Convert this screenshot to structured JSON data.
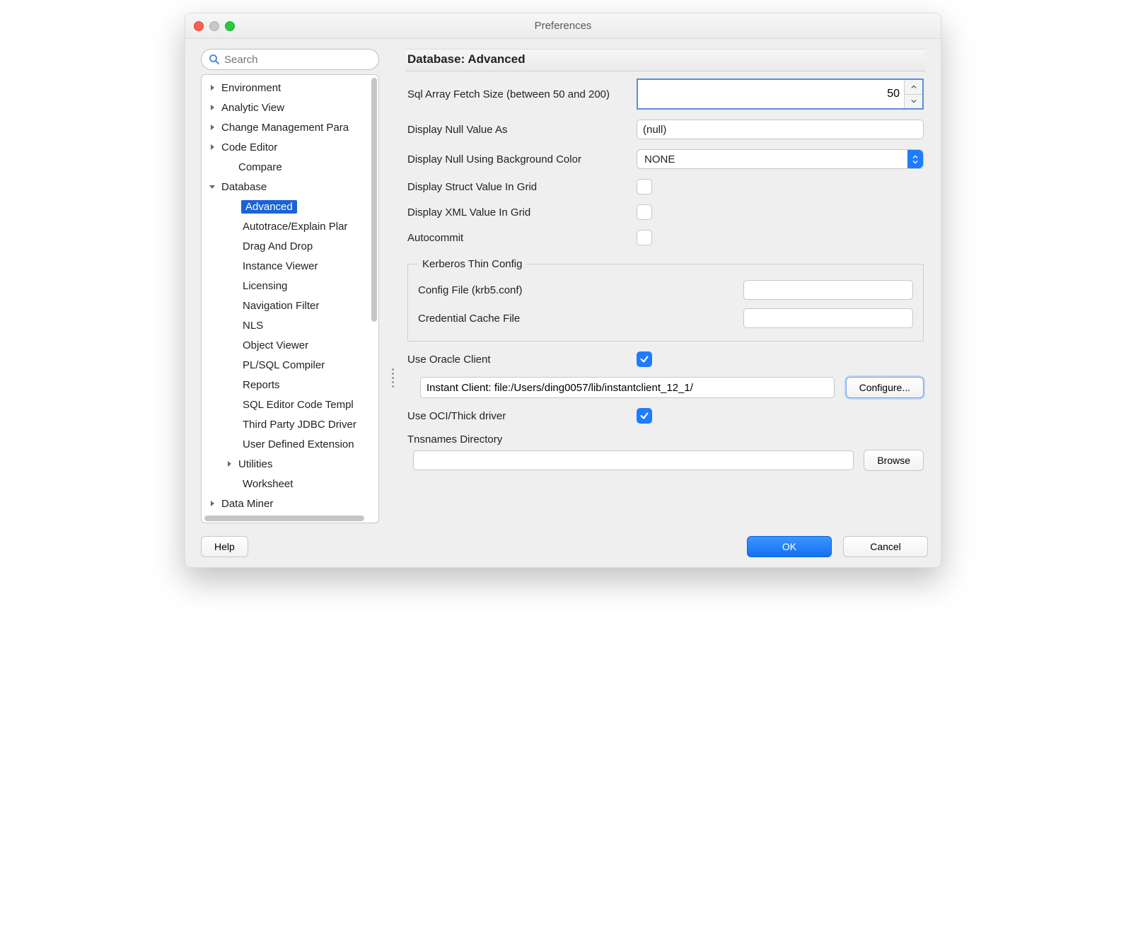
{
  "window": {
    "title": "Preferences"
  },
  "search": {
    "placeholder": "Search"
  },
  "sidebar": {
    "items": [
      {
        "label": "Environment",
        "arrow": "right",
        "depth": 0
      },
      {
        "label": "Analytic View",
        "arrow": "right",
        "depth": 0
      },
      {
        "label": "Change Management Para",
        "arrow": "right",
        "depth": 0
      },
      {
        "label": "Code Editor",
        "arrow": "right",
        "depth": 0
      },
      {
        "label": "Compare",
        "arrow": "",
        "depth": 1
      },
      {
        "label": "Database",
        "arrow": "down",
        "depth": 0
      },
      {
        "label": "Advanced",
        "arrow": "",
        "depth": 2,
        "selected": true
      },
      {
        "label": "Autotrace/Explain Plar",
        "arrow": "",
        "depth": 2
      },
      {
        "label": "Drag And Drop",
        "arrow": "",
        "depth": 2
      },
      {
        "label": "Instance Viewer",
        "arrow": "",
        "depth": 2
      },
      {
        "label": "Licensing",
        "arrow": "",
        "depth": 2
      },
      {
        "label": "Navigation Filter",
        "arrow": "",
        "depth": 2
      },
      {
        "label": "NLS",
        "arrow": "",
        "depth": 2
      },
      {
        "label": "Object Viewer",
        "arrow": "",
        "depth": 2
      },
      {
        "label": "PL/SQL Compiler",
        "arrow": "",
        "depth": 2
      },
      {
        "label": "Reports",
        "arrow": "",
        "depth": 2
      },
      {
        "label": "SQL Editor Code Templ",
        "arrow": "",
        "depth": 2
      },
      {
        "label": "Third Party JDBC Driver",
        "arrow": "",
        "depth": 2
      },
      {
        "label": "User Defined Extension",
        "arrow": "",
        "depth": 2
      },
      {
        "label": "Utilities",
        "arrow": "right",
        "depth": 1
      },
      {
        "label": "Worksheet",
        "arrow": "",
        "depth": 2
      },
      {
        "label": "Data Miner",
        "arrow": "right",
        "depth": 0
      }
    ]
  },
  "panel": {
    "title": "Database: Advanced",
    "fetch_label": "Sql Array Fetch Size (between 50 and 200)",
    "fetch_value": "50",
    "null_label": "Display Null Value As",
    "null_value": "(null)",
    "nullbg_label": "Display Null Using Background Color",
    "nullbg_value": "NONE",
    "struct_label": "Display Struct Value In Grid",
    "xml_label": "Display XML Value In Grid",
    "autocommit_label": "Autocommit",
    "kerb_legend": "Kerberos Thin Config",
    "kerb_config_label": "Config File (krb5.conf)",
    "kerb_cred_label": "Credential Cache File",
    "oracle_label": "Use Oracle Client",
    "client_value": "Instant Client: file:/Users/ding0057/lib/instantclient_12_1/",
    "configure_label": "Configure...",
    "oci_label": "Use OCI/Thick driver",
    "tns_label": "Tnsnames Directory",
    "browse_label": "Browse"
  },
  "footer": {
    "help": "Help",
    "ok": "OK",
    "cancel": "Cancel"
  }
}
